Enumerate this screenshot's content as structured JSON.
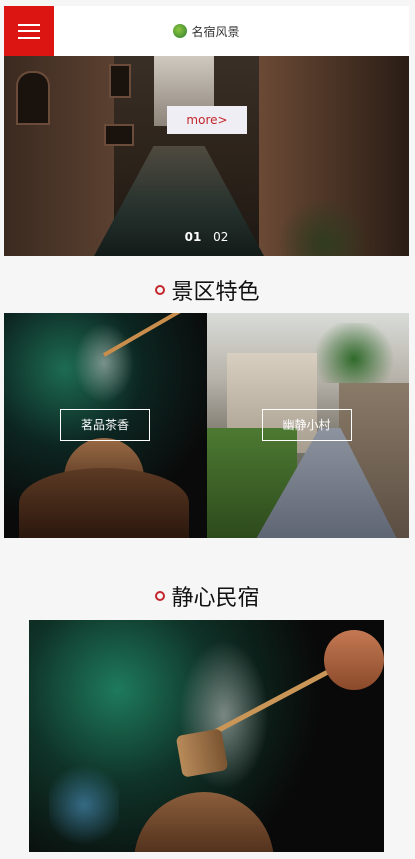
{
  "header": {
    "logo_text": "名宿风景",
    "menu_icon": "hamburger-icon"
  },
  "banner": {
    "more_label": "more>",
    "pages": [
      "01",
      "02"
    ],
    "active_page": "01"
  },
  "features": {
    "title": "景区特色",
    "items": [
      {
        "label": "茗品茶香"
      },
      {
        "label": "幽静小村"
      }
    ]
  },
  "homestay": {
    "title": "静心民宿"
  },
  "colors": {
    "accent": "#dd1512",
    "more_text": "#c3262b",
    "title_dot": "#c3262b",
    "background": "#f6f6f6"
  }
}
